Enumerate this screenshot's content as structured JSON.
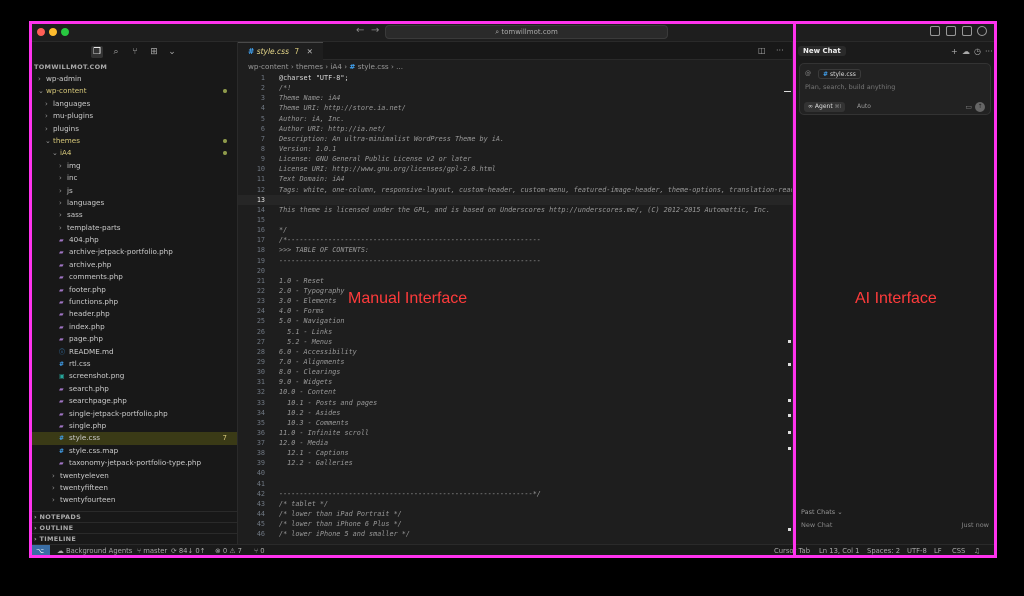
{
  "titlebar": {
    "search_text": "⌕ tomwillmot.com",
    "back": "←",
    "forward": "→"
  },
  "sidebar": {
    "root": "TOMWILLMOT.COM",
    "tree": [
      {
        "label": "wp-admin",
        "depth": 0,
        "type": "folder",
        "open": false
      },
      {
        "label": "wp-content",
        "depth": 0,
        "type": "folder",
        "open": true,
        "modified": true
      },
      {
        "label": "languages",
        "depth": 1,
        "type": "folder",
        "open": false
      },
      {
        "label": "mu-plugins",
        "depth": 1,
        "type": "folder",
        "open": false
      },
      {
        "label": "plugins",
        "depth": 1,
        "type": "folder",
        "open": false
      },
      {
        "label": "themes",
        "depth": 1,
        "type": "folder",
        "open": true,
        "modified": true
      },
      {
        "label": "iA4",
        "depth": 2,
        "type": "folder",
        "open": true,
        "modified": true
      },
      {
        "label": "img",
        "depth": 3,
        "type": "folder",
        "open": false
      },
      {
        "label": "inc",
        "depth": 3,
        "type": "folder",
        "open": false
      },
      {
        "label": "js",
        "depth": 3,
        "type": "folder",
        "open": false
      },
      {
        "label": "languages",
        "depth": 3,
        "type": "folder",
        "open": false
      },
      {
        "label": "sass",
        "depth": 3,
        "type": "folder",
        "open": false
      },
      {
        "label": "template-parts",
        "depth": 3,
        "type": "folder",
        "open": false
      },
      {
        "label": "404.php",
        "depth": 3,
        "type": "php"
      },
      {
        "label": "archive-jetpack-portfolio.php",
        "depth": 3,
        "type": "php"
      },
      {
        "label": "archive.php",
        "depth": 3,
        "type": "php"
      },
      {
        "label": "comments.php",
        "depth": 3,
        "type": "php"
      },
      {
        "label": "footer.php",
        "depth": 3,
        "type": "php"
      },
      {
        "label": "functions.php",
        "depth": 3,
        "type": "php"
      },
      {
        "label": "header.php",
        "depth": 3,
        "type": "php"
      },
      {
        "label": "index.php",
        "depth": 3,
        "type": "php"
      },
      {
        "label": "page.php",
        "depth": 3,
        "type": "php"
      },
      {
        "label": "README.md",
        "depth": 3,
        "type": "info"
      },
      {
        "label": "rtl.css",
        "depth": 3,
        "type": "css"
      },
      {
        "label": "screenshot.png",
        "depth": 3,
        "type": "img"
      },
      {
        "label": "search.php",
        "depth": 3,
        "type": "php"
      },
      {
        "label": "searchpage.php",
        "depth": 3,
        "type": "php"
      },
      {
        "label": "single-jetpack-portfolio.php",
        "depth": 3,
        "type": "php"
      },
      {
        "label": "single.php",
        "depth": 3,
        "type": "php"
      },
      {
        "label": "style.css",
        "depth": 3,
        "type": "css",
        "selected": true,
        "badge": "7"
      },
      {
        "label": "style.css.map",
        "depth": 3,
        "type": "css"
      },
      {
        "label": "taxonomy-jetpack-portfolio-type.php",
        "depth": 3,
        "type": "php"
      },
      {
        "label": "twentyeleven",
        "depth": 2,
        "type": "folder",
        "open": false
      },
      {
        "label": "twentyfifteen",
        "depth": 2,
        "type": "folder",
        "open": false
      },
      {
        "label": "twentyfourteen",
        "depth": 2,
        "type": "folder",
        "open": false
      }
    ],
    "bottom_sections": [
      "NOTEPADS",
      "OUTLINE",
      "TIMELINE"
    ]
  },
  "editor": {
    "tab": {
      "name": "style.css",
      "hash": "#",
      "problems": "7",
      "close": "✕"
    },
    "breadcrumbs": [
      "wp-content",
      "themes",
      "iA4",
      "style.css",
      "..."
    ],
    "current_line": 13,
    "lines": [
      {
        "n": 1,
        "t": "@charset \"UTF-8\";",
        "k": "plain"
      },
      {
        "n": 2,
        "t": "/*!"
      },
      {
        "n": 3,
        "t": "Theme Name: iA4"
      },
      {
        "n": 4,
        "t": "Theme URI: http://store.ia.net/"
      },
      {
        "n": 5,
        "t": "Author: iA, Inc."
      },
      {
        "n": 6,
        "t": "Author URI: http://ia.net/"
      },
      {
        "n": 7,
        "t": "Description: An ultra-minimalist WordPress Theme by iA."
      },
      {
        "n": 8,
        "t": "Version: 1.0.1"
      },
      {
        "n": 9,
        "t": "License: GNU General Public License v2 or later"
      },
      {
        "n": 10,
        "t": "License URI: http://www.gnu.org/licenses/gpl-2.0.html"
      },
      {
        "n": 11,
        "t": "Text Domain: iA4"
      },
      {
        "n": 12,
        "t": "Tags: white, one-column, responsive-layout, custom-header, custom-menu, featured-image-header, theme-options, translation-ready"
      },
      {
        "n": 13,
        "t": ""
      },
      {
        "n": 14,
        "t": "This theme is licensed under the GPL, and is based on Underscores http://underscores.me/, (C) 2012-2015 Automattic, Inc."
      },
      {
        "n": 15,
        "t": ""
      },
      {
        "n": 16,
        "t": "*/"
      },
      {
        "n": 17,
        "t": "/*--------------------------------------------------------------"
      },
      {
        "n": 18,
        "t": ">>> TABLE OF CONTENTS:"
      },
      {
        "n": 19,
        "t": "----------------------------------------------------------------"
      },
      {
        "n": 20,
        "t": ""
      },
      {
        "n": 21,
        "t": "1.0 - Reset"
      },
      {
        "n": 22,
        "t": "2.0 - Typography"
      },
      {
        "n": 23,
        "t": "3.0 - Elements"
      },
      {
        "n": 24,
        "t": "4.0 - Forms"
      },
      {
        "n": 25,
        "t": "5.0 - Navigation"
      },
      {
        "n": 26,
        "t": "  5.1 - Links"
      },
      {
        "n": 27,
        "t": "  5.2 - Menus"
      },
      {
        "n": 28,
        "t": "6.0 - Accessibility"
      },
      {
        "n": 29,
        "t": "7.0 - Alignments"
      },
      {
        "n": 30,
        "t": "8.0 - Clearings"
      },
      {
        "n": 31,
        "t": "9.0 - Widgets"
      },
      {
        "n": 32,
        "t": "10.0 - Content"
      },
      {
        "n": 33,
        "t": "  10.1 - Posts and pages"
      },
      {
        "n": 34,
        "t": "  10.2 - Asides"
      },
      {
        "n": 35,
        "t": "  10.3 - Comments"
      },
      {
        "n": 36,
        "t": "11.0 - Infinite scroll"
      },
      {
        "n": 37,
        "t": "12.0 - Media"
      },
      {
        "n": 38,
        "t": "  12.1 - Captions"
      },
      {
        "n": 39,
        "t": "  12.2 - Galleries"
      },
      {
        "n": 40,
        "t": ""
      },
      {
        "n": 41,
        "t": ""
      },
      {
        "n": 42,
        "t": "--------------------------------------------------------------*/"
      },
      {
        "n": 43,
        "t": "/* tablet */"
      },
      {
        "n": 44,
        "t": "/* lower than iPad Portrait */"
      },
      {
        "n": 45,
        "t": "/* lower than iPhone 6 Plus */"
      },
      {
        "n": 46,
        "t": "/* lower iPhone 5 and smaller */"
      }
    ]
  },
  "ai_panel": {
    "tab_label": "New Chat",
    "context_file": "style.css",
    "context_hash": "#",
    "at_symbol": "@",
    "placeholder": "Plan, search, build anything",
    "agent_label": "Agent",
    "agent_shortcut": "⌘I",
    "model_label": "Auto",
    "past_chats_label": "Past Chats ⌄",
    "past_chat": {
      "title": "New Chat",
      "time": "Just now"
    }
  },
  "statusbar": {
    "background_agents": "Background Agents",
    "branch": "master",
    "sync": "84↓ 0↑",
    "problems": "⊗ 0 ⚠ 7",
    "ports": "⑂ 0",
    "cursor_tab": "Cursor Tab",
    "position": "Ln 13, Col 1",
    "spaces": "Spaces: 2",
    "encoding": "UTF-8",
    "eol": "LF",
    "language": "CSS"
  },
  "overlay": {
    "manual": "Manual Interface",
    "ai": "AI Interface"
  },
  "colors": {
    "frame": "#ff33ee",
    "overlay_text": "#ff3b3b",
    "modified": "#d8c97a",
    "css_icon": "#42a5f5"
  }
}
